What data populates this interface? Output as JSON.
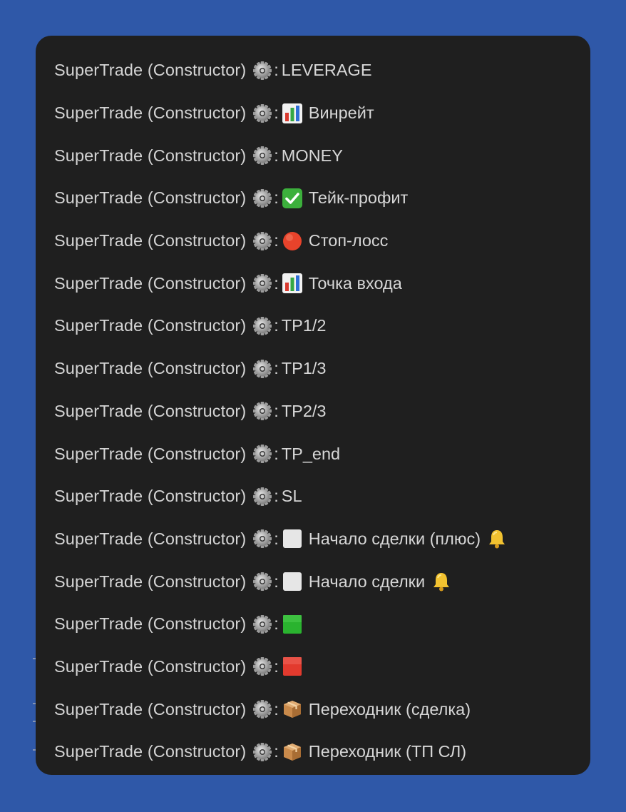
{
  "items": [
    {
      "label": "SuperTrade (Constructor)",
      "icon": "",
      "value": "LEVERAGE",
      "trailing_icon": ""
    },
    {
      "label": "SuperTrade (Constructor)",
      "icon": "bar-chart",
      "value": "Винрейт",
      "trailing_icon": ""
    },
    {
      "label": "SuperTrade (Constructor)",
      "icon": "",
      "value": "MONEY",
      "trailing_icon": ""
    },
    {
      "label": "SuperTrade (Constructor)",
      "icon": "check",
      "value": "Тейк-профит",
      "trailing_icon": ""
    },
    {
      "label": "SuperTrade (Constructor)",
      "icon": "stop",
      "value": "Стоп-лосс",
      "trailing_icon": ""
    },
    {
      "label": "SuperTrade (Constructor)",
      "icon": "bar-chart",
      "value": "Точка входа",
      "trailing_icon": ""
    },
    {
      "label": "SuperTrade (Constructor)",
      "icon": "",
      "value": "TP1/2",
      "trailing_icon": ""
    },
    {
      "label": "SuperTrade (Constructor)",
      "icon": "",
      "value": "TP1/3",
      "trailing_icon": ""
    },
    {
      "label": "SuperTrade (Constructor)",
      "icon": "",
      "value": "TP2/3",
      "trailing_icon": ""
    },
    {
      "label": "SuperTrade (Constructor)",
      "icon": "",
      "value": "TP_end",
      "trailing_icon": ""
    },
    {
      "label": "SuperTrade (Constructor)",
      "icon": "",
      "value": "SL",
      "trailing_icon": ""
    },
    {
      "label": "SuperTrade (Constructor)",
      "icon": "white-square",
      "value": "Начало сделки (плюс)",
      "trailing_icon": "bell"
    },
    {
      "label": "SuperTrade (Constructor)",
      "icon": "white-square",
      "value": "Начало сделки",
      "trailing_icon": "bell"
    },
    {
      "label": "SuperTrade (Constructor)",
      "icon": "green-square",
      "value": "",
      "trailing_icon": ""
    },
    {
      "label": "SuperTrade (Constructor)",
      "icon": "red-square",
      "value": "",
      "trailing_icon": ""
    },
    {
      "label": "SuperTrade (Constructor)",
      "icon": "package",
      "value": "Переходник (сделка)",
      "trailing_icon": ""
    },
    {
      "label": "SuperTrade (Constructor)",
      "icon": "package",
      "value": "Переходник (ТП СЛ)",
      "trailing_icon": ""
    }
  ],
  "colors": {
    "page_background": "#2f58a8",
    "panel_background": "#1f1f1f",
    "text": "#d7d7d7"
  }
}
